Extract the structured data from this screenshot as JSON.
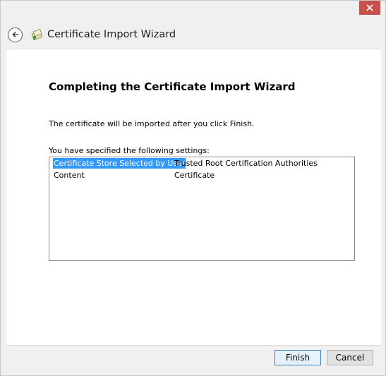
{
  "window": {
    "title": "Certificate Import Wizard",
    "close_icon": "close-icon",
    "accent_close": "#c7514a"
  },
  "header": {
    "back_icon": "back-arrow-icon",
    "wizard_icon": "certificate-icon",
    "title": "Certificate Import Wizard"
  },
  "main": {
    "heading": "Completing the Certificate Import Wizard",
    "description": "The certificate will be imported after you click Finish.",
    "settings_label": "You have specified the following settings:",
    "settings": [
      {
        "key": "Certificate Store Selected by User",
        "value": "Trusted Root Certification Authorities",
        "selected": true
      },
      {
        "key": "Content",
        "value": "Certificate",
        "selected": false
      }
    ],
    "selection_color": "#3399ff"
  },
  "footer": {
    "finish_label": "Finish",
    "cancel_label": "Cancel"
  }
}
